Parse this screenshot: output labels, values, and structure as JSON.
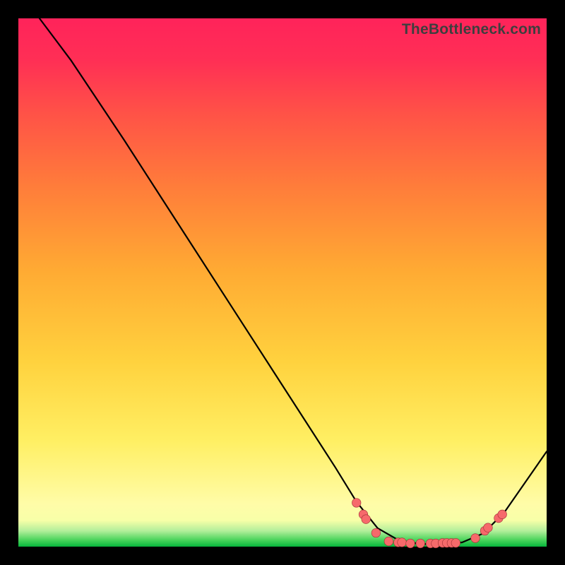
{
  "watermark": "TheBottleneck.com",
  "chart_data": {
    "type": "line",
    "title": "",
    "xlabel": "",
    "ylabel": "",
    "xlim": [
      0,
      100
    ],
    "ylim": [
      0,
      100
    ],
    "grid": false,
    "legend": false,
    "series": [
      {
        "name": "curve",
        "x": [
          4,
          10,
          20,
          30,
          40,
          50,
          60,
          64,
          68,
          72,
          76,
          80,
          84,
          88,
          92,
          100
        ],
        "y": [
          100,
          92,
          77,
          61.5,
          46,
          30.5,
          15,
          8.5,
          3.5,
          1.2,
          0.5,
          0.5,
          0.8,
          2.5,
          6.5,
          18
        ]
      }
    ],
    "markers": [
      {
        "x": 64.0,
        "y": 8.3
      },
      {
        "x": 65.3,
        "y": 6.1
      },
      {
        "x": 65.8,
        "y": 5.2
      },
      {
        "x": 67.7,
        "y": 2.6
      },
      {
        "x": 70.1,
        "y": 1.0
      },
      {
        "x": 71.9,
        "y": 0.8
      },
      {
        "x": 72.6,
        "y": 0.8
      },
      {
        "x": 74.2,
        "y": 0.6
      },
      {
        "x": 76.1,
        "y": 0.6
      },
      {
        "x": 78.0,
        "y": 0.6
      },
      {
        "x": 79.0,
        "y": 0.6
      },
      {
        "x": 80.3,
        "y": 0.7
      },
      {
        "x": 81.1,
        "y": 0.7
      },
      {
        "x": 82.0,
        "y": 0.7
      },
      {
        "x": 82.8,
        "y": 0.7
      },
      {
        "x": 86.5,
        "y": 1.6
      },
      {
        "x": 88.3,
        "y": 3.0
      },
      {
        "x": 88.9,
        "y": 3.6
      },
      {
        "x": 90.9,
        "y": 5.4
      },
      {
        "x": 91.6,
        "y": 6.1
      }
    ],
    "colors": {
      "curve_stroke": "#000000",
      "marker_fill": "#f66a6b",
      "marker_stroke": "#9e2f34"
    }
  }
}
